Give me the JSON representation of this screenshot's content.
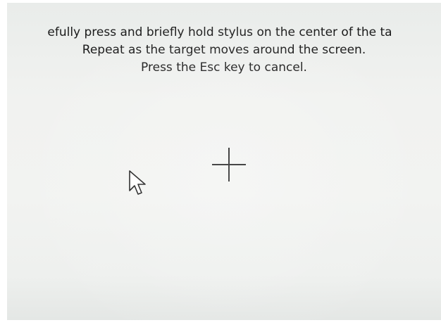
{
  "calibration": {
    "instruction_line_1": "efully press and briefly hold stylus on the center of the ta",
    "instruction_line_2": "Repeat as the target moves around the screen.",
    "instruction_line_3": "Press the Esc key to cancel."
  },
  "icons": {
    "target": "crosshair-target-icon",
    "pointer": "mouse-pointer-icon"
  },
  "colors": {
    "screen_background": "#f1f2f0",
    "text": "#1a1a1a",
    "target": "#111111"
  }
}
